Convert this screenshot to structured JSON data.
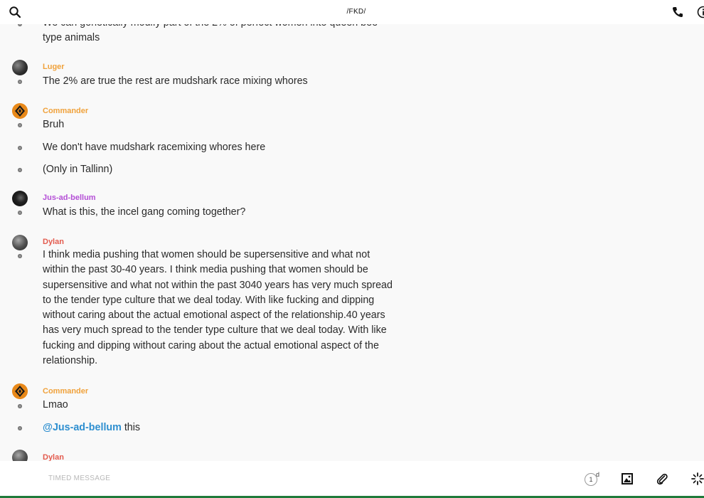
{
  "header": {
    "title": "/FKD/",
    "search_icon": "search-icon",
    "call_icon": "phone-icon",
    "info_icon": "info-icon"
  },
  "messages": [
    {
      "kind": "continuation",
      "text": "We can genetically modify part of the 2% of perfect women into queen bee type animals"
    },
    {
      "kind": "header",
      "author": "Luger",
      "avatar": "avatar-grey",
      "text": "The 2% are true the rest are mudshark race mixing whores"
    },
    {
      "kind": "header",
      "author": "Commander",
      "avatar": "avatar-commander",
      "text": "Bruh"
    },
    {
      "kind": "continuation",
      "text": "We don't have mudshark racemixing whores here"
    },
    {
      "kind": "continuation",
      "text": "(Only in Tallinn)"
    },
    {
      "kind": "header",
      "author": "Jus-ad-bellum",
      "avatar": "avatar-dark",
      "text": "What is this, the incel gang coming together?"
    },
    {
      "kind": "header",
      "author": "Dylan",
      "avatar": "avatar-mist",
      "text": "I think media pushing that women should be supersensitive and what not within the past 30-40 years.  I think media pushing that women should be supersensitive and what not within the past 3040 years has very much spread to the tender type culture that we deal today. With like fucking and dipping without caring about the actual emotional aspect of the relationship.40 years has very much spread to the tender type culture that we deal today. With like fucking and dipping without caring about the actual emotional aspect of the relationship."
    },
    {
      "kind": "header",
      "author": "Commander",
      "avatar": "avatar-commander",
      "text": "Lmao"
    },
    {
      "kind": "continuation",
      "mention": "@Jus-ad-bellum",
      "text": " this"
    },
    {
      "kind": "header",
      "author": "Dylan",
      "avatar": "avatar-mist",
      "text": ""
    }
  ],
  "composer": {
    "placeholder": "TIMED MESSAGE",
    "timer_value": "1",
    "timer_unit": "d",
    "icons": [
      "timer-icon",
      "image-icon",
      "paperclip-icon",
      "sparkle-icon"
    ]
  },
  "colors": {
    "commander": "#f0a23c",
    "luger": "#f0a23c",
    "jus_ad_bellum": "#b44fd6",
    "dylan": "#e35b4e",
    "mention": "#2e8fd0",
    "bottom_bar": "#1f7a3a"
  }
}
